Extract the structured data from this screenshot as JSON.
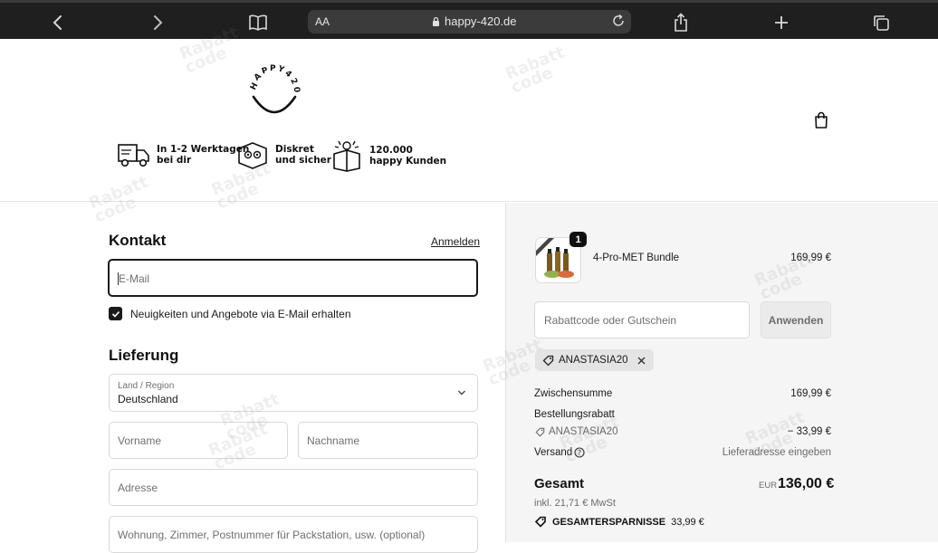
{
  "browser": {
    "text_size_label": "AA",
    "url": "happy-420.de"
  },
  "header": {
    "logo_text": "HAPPY420",
    "trust": [
      {
        "text": "In 1-2 Werktagen\nbei dir",
        "icon": "delivery-truck-icon"
      },
      {
        "text": "Diskret\nund sicher",
        "icon": "discreet-package-icon"
      },
      {
        "text": "120.000\nhappy Kunden",
        "icon": "happy-customers-box-icon"
      }
    ]
  },
  "contact": {
    "heading": "Kontakt",
    "login_link": "Anmelden",
    "email_placeholder": "E-Mail",
    "newsletter_label": "Neuigkeiten und Angebote via E-Mail erhalten",
    "newsletter_checked": true
  },
  "delivery": {
    "heading": "Lieferung",
    "country_label": "Land / Region",
    "country_value": "Deutschland",
    "first_name_placeholder": "Vorname",
    "last_name_placeholder": "Nachname",
    "address_placeholder": "Adresse",
    "apartment_placeholder": "Wohnung, Zimmer, Postnummer für Packstation, usw. (optional)"
  },
  "order": {
    "item": {
      "name": "4-Pro-MET Bundle",
      "price": "169,99 €",
      "quantity": "1"
    },
    "discount_placeholder": "Rabattcode oder Gutschein",
    "apply_label": "Anwenden",
    "applied_code": "ANASTASIA20",
    "subtotal_label": "Zwischensumme",
    "subtotal_value": "169,99 €",
    "order_discount_label": "Bestellungsrabatt",
    "order_discount_code": "ANASTASIA20",
    "order_discount_value": "− 33,99 €",
    "shipping_label": "Versand",
    "shipping_value": "Lieferadresse eingeben",
    "total_label": "Gesamt",
    "total_currency": "EUR",
    "total_value": "136,00 €",
    "tax_note": "inkl. 21,71 € MwSt",
    "savings_label": "GESAMTERSPARNISSE",
    "savings_value": "33,99 €"
  },
  "watermark_text": "Rabatt\ncode"
}
